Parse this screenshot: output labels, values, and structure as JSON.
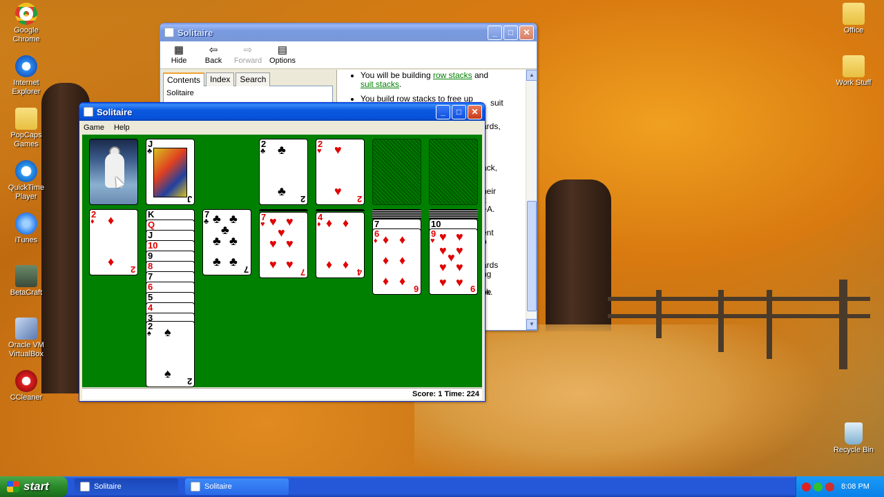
{
  "desktop_icons": [
    {
      "label": "Google Chrome",
      "icon": "chrome-icon"
    },
    {
      "label": "Internet Explorer",
      "icon": "ie-icon"
    },
    {
      "label": "PopCaps Games",
      "icon": "folder-icon"
    },
    {
      "label": "QuickTime Player",
      "icon": "quicktime-icon"
    },
    {
      "label": "iTunes",
      "icon": "itunes-icon"
    },
    {
      "label": "BetaCraft",
      "icon": "betacraft-icon"
    },
    {
      "label": "Oracle VM VirtualBox",
      "icon": "virtualbox-icon"
    },
    {
      "label": "CCleaner",
      "icon": "ccleaner-icon"
    }
  ],
  "desktop_icons_right": [
    {
      "label": "Office",
      "icon": "folder-icon"
    },
    {
      "label": "Work Stuff",
      "icon": "folder-icon"
    },
    {
      "label": "Recycle Bin",
      "icon": "recycle-bin-icon"
    }
  ],
  "help_window": {
    "title": "Solitaire",
    "toolbar": {
      "hide": "Hide",
      "back": "Back",
      "forward": "Forward",
      "options": "Options"
    },
    "tabs": [
      "Contents",
      "Index",
      "Search"
    ],
    "tree_item": "Solitaire",
    "text": {
      "b1_pre": "You will be building ",
      "b1_link1": "row stacks",
      "b1_mid": " and",
      "b1_link2": "suit stacks",
      "b1_end": ".",
      "b2": "You build row stacks to free up",
      "fragments": [
        "suit",
        "ards,",
        ".",
        "ack,",
        "neir",
        "k",
        "+A.",
        "ent",
        "o",
        "ards",
        "ng",
        "t be",
        "ck."
      ]
    }
  },
  "solitaire": {
    "title": "Solitaire",
    "menu": {
      "game": "Game",
      "help": "Help"
    },
    "status": "Score: 1 Time: 224",
    "waste": {
      "rank": "J",
      "suit": "♣"
    },
    "foundations": [
      {
        "rank": "2",
        "suit": "♣",
        "color": "black"
      },
      {
        "rank": "2",
        "suit": "♥",
        "color": "red"
      }
    ],
    "tableau": [
      {
        "rank": "2",
        "suit": "♦",
        "color": "red"
      },
      {
        "cascade": [
          "K",
          "Q",
          "J",
          "10",
          "9",
          "8",
          "7",
          "6",
          "5",
          "4",
          "3"
        ],
        "top": {
          "rank": "2",
          "suit": "♠",
          "color": "black"
        }
      },
      {
        "rank": "7",
        "suit": "♣",
        "color": "black"
      },
      {
        "rank": "7",
        "suit": "♥",
        "color": "red"
      },
      {
        "rank": "4",
        "suit": "♦",
        "color": "red"
      },
      {
        "under_rank": "7",
        "rank": "6",
        "suit": "♦",
        "color": "red"
      },
      {
        "under_rank": "10",
        "rank": "9",
        "suit": "♥",
        "color": "red"
      }
    ]
  },
  "taskbar": {
    "start": "start",
    "tasks": [
      "Solitaire",
      "Solitaire"
    ],
    "clock": "8:08 PM"
  },
  "colors": {
    "felt": "#008000",
    "xp_blue": "#0a5ae0",
    "card_red": "#e00000"
  }
}
